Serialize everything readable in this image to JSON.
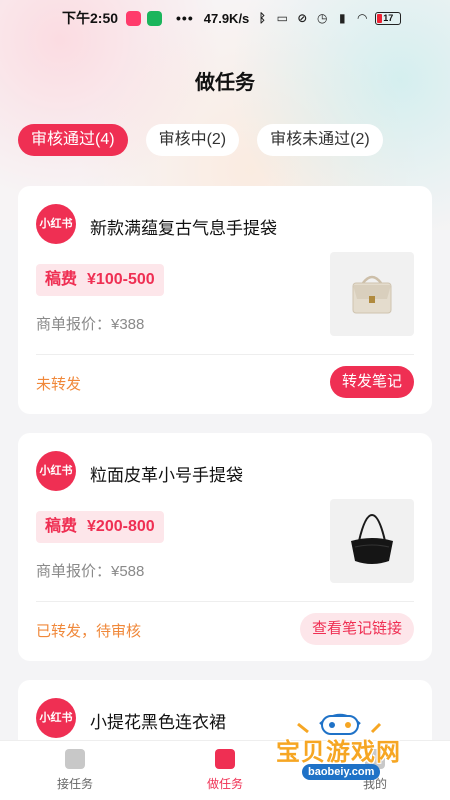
{
  "status_bar": {
    "time": "下午2:50",
    "dots": "•••",
    "speed": "47.9K/s",
    "battery": "17"
  },
  "page": {
    "title": "做任务"
  },
  "tabs": [
    {
      "label": "审核通过(4)",
      "active": true
    },
    {
      "label": "审核中(2)",
      "active": false
    },
    {
      "label": "审核未通过(2)",
      "active": false
    }
  ],
  "cards": [
    {
      "logo": "小红书",
      "title": "新款满蕴复古气息手提袋",
      "fee_label": "稿费",
      "fee_range": "¥100-500",
      "price": "商单报价：¥388",
      "status": "未转发",
      "action": "转发笔记"
    },
    {
      "logo": "小红书",
      "title": "粒面皮革小号手提袋",
      "fee_label": "稿费",
      "fee_range": "¥200-800",
      "price": "商单报价：¥588",
      "status": "已转发，待审核",
      "action": "查看笔记链接"
    },
    {
      "logo": "小红书",
      "title": "小提花黑色连衣裙"
    }
  ],
  "bottom_nav": [
    {
      "label": "接任务",
      "active": false
    },
    {
      "label": "做任务",
      "active": true
    },
    {
      "label": "我的",
      "active": false
    }
  ],
  "watermark": {
    "text": "宝贝游戏网",
    "url": "baobeiy.com"
  },
  "colors": {
    "accent": "#ef2f53",
    "status_orange": "#f0883a",
    "fee_bg": "#fde6ea"
  }
}
